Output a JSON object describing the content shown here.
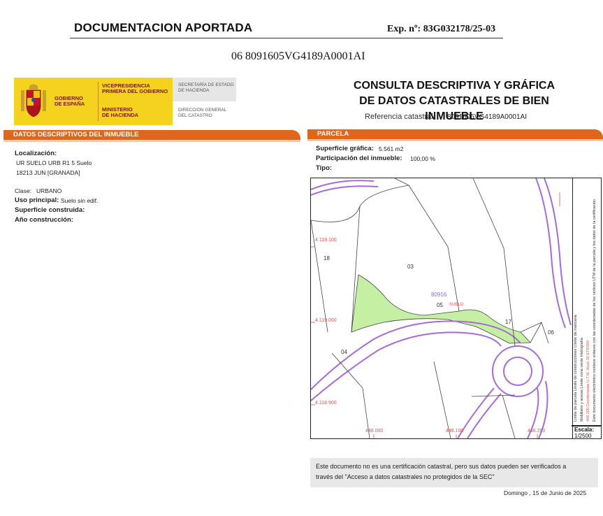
{
  "header": {
    "title": "DOCUMENTACION APORTADA",
    "exp_number": "Exp. nº: 83G032178/25-03",
    "reference": "06 8091605VG4189A0001AI"
  },
  "logo": {
    "gobierno": "GOBIERNO\nDE ESPAÑA",
    "vicepresidencia": "VICEPRESIDENCIA\nPRIMERA DEL GOBIERNO",
    "ministerio": "MINISTERIO\nDE HACIENDA",
    "secretaria": "SECRETARÍA DE ESTADO\nDE HACIENDA",
    "direccion": "DIRECCIÓN GENERAL\nDEL CATASTRO",
    "colors": {
      "yellow": "#f5d21d",
      "red": "#aa151b"
    }
  },
  "consulta": {
    "title_line1": "CONSULTA DESCRIPTIVA Y GRÁFICA",
    "title_line2": "DE DATOS CATASTRALES DE BIEN INMUEBLE",
    "ref_label": "Referencia catastral:",
    "ref_value": "8091605VG4189A0001AI"
  },
  "left_section": {
    "bar_label": "DATOS DESCRIPTIVOS DEL INMUEBLE",
    "localizacion_label": "Localización:",
    "localizacion_line1": "UR SUELO URB R1 5 Suelo",
    "localizacion_line2": "18213 JUN [GRANADA]",
    "clase_label": "Clase:",
    "clase_value": "URBANO",
    "uso_label": "Uso principal:",
    "uso_value": "Suelo sin edif.",
    "superficie_label": "Superficie construida:",
    "ano_label": "Año construcción:"
  },
  "right_section": {
    "bar_label": "PARCELA",
    "superficie_label": "Superficie gráfica:",
    "superficie_value": "5.561 m2",
    "participacion_label": "Participación del inmueble:",
    "participacion_value": "100,00 %",
    "tipo_label": "Tipo:"
  },
  "map": {
    "y_labels": [
      "4.119.100",
      "4.119.000",
      "4.118.900"
    ],
    "x_labels": [
      "448.000",
      "448.100",
      "448.200"
    ],
    "parcel_labels": [
      "18",
      "03",
      "05",
      "17",
      "06",
      "04"
    ],
    "parcel_ref": "80916",
    "parcel_sub": "SUELO",
    "colors": {
      "highlight": "#c5f0a4",
      "road": "#a86ad6",
      "line": "#444444",
      "coord": "#e05050"
    }
  },
  "legend": {
    "line1": "Límite de parcela    Límite de construcciones    Límite de manzana",
    "line2": "Mobiliario y aceras    Límite zona verde    Hidrografía",
    "line3": "448.200 Coordenadas U.T.M. Huso 30 ETRS89",
    "line4": "Este documento electrónico contiene enlaces con las coordenadas de los vértices UTM de la parcela y los datos de la certificación"
  },
  "scale": {
    "label": "Escala:",
    "value": "1/2500"
  },
  "notice": {
    "line1": "Este documento no es una certificación catastral, pero sus datos pueden ser verificados a",
    "line2": "través del \"Acceso a datos catastrales no protegidos de la SEC\""
  },
  "footer": {
    "date": "Domingo , 15 de Junio de 2025"
  }
}
